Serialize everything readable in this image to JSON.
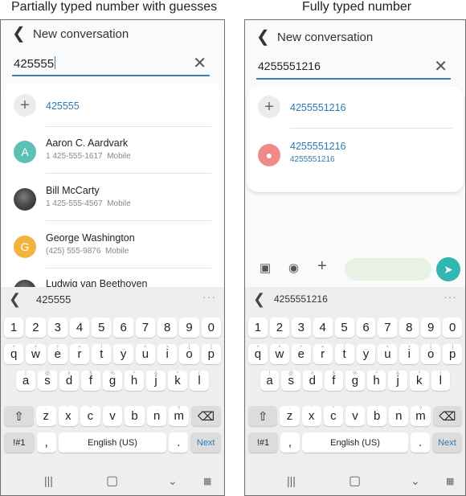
{
  "captions": {
    "left": "Partially typed number with guesses",
    "right": "Fully typed number"
  },
  "icons": {
    "back": "back-chevron-icon",
    "clear": "close-icon",
    "add": "plus-icon",
    "image": "image-icon",
    "camera": "camera-icon",
    "send": "send-icon",
    "shift": "shift-icon",
    "backspace": "backspace-icon"
  },
  "colors": {
    "accent": "#2c7bb5",
    "send": "#2fb7b0",
    "avatar_a": "#5bc1b4",
    "avatar_g": "#f4b43b",
    "avatar_contact": "#f08a8a"
  },
  "left": {
    "header_title": "New conversation",
    "input_value": "425555",
    "suggestions": [
      {
        "title": "425555"
      },
      {
        "initial": "A",
        "name": "Aaron C. Aardvark",
        "number": "1 425-555-1617",
        "type": "Mobile"
      },
      {
        "name": "Bill McCarty",
        "number": "1 425-555-4567",
        "type": "Mobile"
      },
      {
        "initial": "G",
        "name": "George Washington",
        "number": "(425) 555-9876",
        "type": "Mobile"
      },
      {
        "name": "Ludwig van Beethoven"
      }
    ],
    "keyboard": {
      "suggestion": "425555",
      "language": "English (US)",
      "action": "Next",
      "symbols": "!#1",
      "comma": ","
    }
  },
  "right": {
    "header_title": "New conversation",
    "input_value": "4255551216",
    "suggestions": [
      {
        "title": "4255551216"
      },
      {
        "title": "4255551216",
        "sub": "4255551216"
      }
    ],
    "keyboard": {
      "suggestion": "4255551216",
      "language": "English (US)",
      "action": "Next",
      "symbols": "!#1",
      "comma": ","
    }
  },
  "keys": {
    "numbers": [
      "1",
      "2",
      "3",
      "4",
      "5",
      "6",
      "7",
      "8",
      "9",
      "0"
    ],
    "row1": [
      "q",
      "w",
      "e",
      "r",
      "t",
      "y",
      "u",
      "i",
      "o",
      "p"
    ],
    "row1_hints": [
      "+",
      "×",
      "÷",
      "=",
      "/",
      "_",
      "<",
      ">",
      "[",
      "]"
    ],
    "row2": [
      "a",
      "s",
      "d",
      "f",
      "g",
      "h",
      "j",
      "k",
      "l"
    ],
    "row2_hints": [
      "!",
      "@",
      "#",
      "$",
      "%",
      "^",
      "&",
      "*",
      "("
    ],
    "row3": [
      "z",
      "x",
      "c",
      "v",
      "b",
      "n",
      "m"
    ],
    "row3_hints": [
      "-",
      "'",
      "\"",
      ":",
      ";",
      ",",
      "?"
    ]
  }
}
